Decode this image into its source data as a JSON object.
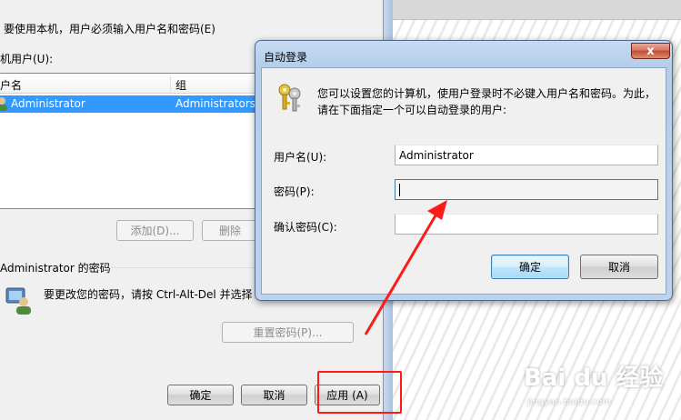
{
  "user_accounts": {
    "instruction": "要使用本机，用户必须输入用户名和密码(E)",
    "list_label": "机用户(U):",
    "columns": [
      "户名",
      "组"
    ],
    "rows": [
      {
        "name": "Administrator",
        "group": "Administrators"
      }
    ],
    "add_button": "添加(D)...",
    "delete_button": "删除",
    "password_section_title": "Administrator 的密码",
    "password_hint": "要更改您的密码，请按 Ctrl-Alt-Del 并选择",
    "reset_password_button": "重置密码(P)...",
    "ok_button": "确定",
    "cancel_button": "取消",
    "apply_button": "应用 (A)"
  },
  "auto_login": {
    "title": "自动登录",
    "close_glyph": "x",
    "description_line1": "您可以设置您的计算机，使用户登录时不必键入用户名和密码。为此，",
    "description_line2": "请在下面指定一个可以自动登录的用户:",
    "username_label": "用户名(U):",
    "username_value": "Administrator",
    "password_label": "密码(P):",
    "password_value": "",
    "confirm_label": "确认密码(C):",
    "confirm_value": "",
    "ok_button": "确定",
    "cancel_button": "取消"
  },
  "icons": {
    "keys": "keys-icon",
    "user": "user-icon",
    "password_user": "user-password-icon"
  },
  "colors": {
    "selection": "#3399ff",
    "annotation_red": "#ff1a1a",
    "title_bar": "#bcd3ee"
  },
  "watermark": {
    "logo": "Bai du 经验",
    "url": "jingyan.baidu.com"
  }
}
